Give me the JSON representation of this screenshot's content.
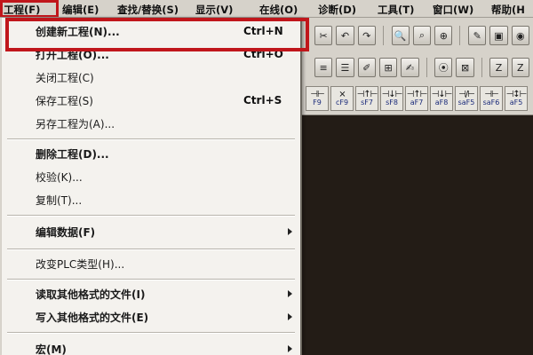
{
  "menubar": {
    "items": [
      {
        "label": "工程(F)"
      },
      {
        "label": "编辑(E)"
      },
      {
        "label": "查找/替换(S)"
      },
      {
        "label": "显示(V)"
      },
      {
        "label": "在线(O)"
      },
      {
        "label": "诊断(D)"
      },
      {
        "label": "工具(T)"
      },
      {
        "label": "窗口(W)"
      },
      {
        "label": "帮助(H"
      }
    ]
  },
  "file_menu": {
    "items": [
      {
        "label": "创建新工程(N)...",
        "shortcut": "Ctrl+N"
      },
      {
        "label": "打开工程(O)...",
        "shortcut": "Ctrl+O"
      },
      {
        "label": "关闭工程(C)"
      },
      {
        "label": "保存工程(S)",
        "shortcut": "Ctrl+S"
      },
      {
        "label": "另存工程为(A)..."
      },
      {
        "label": "删除工程(D)..."
      },
      {
        "label": "校验(K)..."
      },
      {
        "label": "复制(T)..."
      },
      {
        "label": "编辑数据(F)",
        "submenu": true
      },
      {
        "label": "改变PLC类型(H)..."
      },
      {
        "label": "读取其他格式的文件(I)",
        "submenu": true
      },
      {
        "label": "写入其他格式的文件(E)",
        "submenu": true
      },
      {
        "label": "宏(M)",
        "submenu": true
      }
    ]
  },
  "toolbar": {
    "ladder_keys": [
      "F9",
      "cF9",
      "sF7",
      "sF8",
      "aF7",
      "aF8",
      "saF5",
      "saF6",
      "aF5"
    ]
  },
  "colors": {
    "highlight": "#c0161b",
    "workarea": "#231c16"
  }
}
